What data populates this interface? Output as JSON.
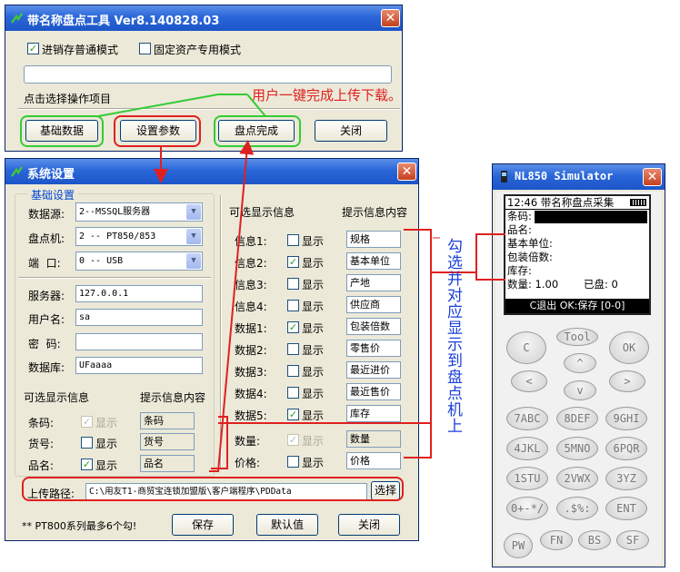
{
  "win1": {
    "title": "带名称盘点工具 Ver8.140828.03",
    "mode_normal": "进销存普通模式",
    "mode_asset": "固定资产专用模式",
    "hint": "点击选择操作项目",
    "btn_basic": "基础数据",
    "btn_params": "设置参数",
    "btn_done": "盘点完成",
    "btn_close": "关闭",
    "callout": "用户一键完成上传下载。"
  },
  "win2": {
    "title": "系统设置",
    "basic_group": "基础设置",
    "labels": {
      "datasource": "数据源:",
      "device": "盘点机:",
      "port": "端  口:",
      "server": "服务器:",
      "user": "用户名:",
      "password": "密  码:",
      "database": "数据库:"
    },
    "datasource_value": "2--MSSQL服务器",
    "device_value": "2 -- PT850/853",
    "port_value": "0 -- USB",
    "server_value": "127.0.0.1",
    "user_value": "sa",
    "password_value": "",
    "database_value": "UFaaaa",
    "left_hdr_opt": "可选显示信息",
    "left_hdr_prompt": "提示信息内容",
    "left_rows": [
      {
        "label": "条码:",
        "show": "显示",
        "checked": true,
        "disabled": true,
        "prompt": "条码"
      },
      {
        "label": "货号:",
        "show": "显示",
        "checked": false,
        "disabled": false,
        "prompt": "货号"
      },
      {
        "label": "品名:",
        "show": "显示",
        "checked": true,
        "disabled": false,
        "prompt": "品名"
      }
    ],
    "right_hdr_opt": "可选显示信息",
    "right_hdr_prompt": "提示信息内容",
    "right_rows": [
      {
        "label": "信息1:",
        "show": "显示",
        "checked": false,
        "disabled": false,
        "prompt": "规格"
      },
      {
        "label": "信息2:",
        "show": "显示",
        "checked": true,
        "disabled": false,
        "prompt": "基本单位"
      },
      {
        "label": "信息3:",
        "show": "显示",
        "checked": false,
        "disabled": false,
        "prompt": "产地"
      },
      {
        "label": "信息4:",
        "show": "显示",
        "checked": false,
        "disabled": false,
        "prompt": "供应商"
      },
      {
        "label": "数据1:",
        "show": "显示",
        "checked": true,
        "disabled": false,
        "prompt": "包装倍数"
      },
      {
        "label": "数据2:",
        "show": "显示",
        "checked": false,
        "disabled": false,
        "prompt": "零售价"
      },
      {
        "label": "数据3:",
        "show": "显示",
        "checked": false,
        "disabled": false,
        "prompt": "最近进价"
      },
      {
        "label": "数据4:",
        "show": "显示",
        "checked": false,
        "disabled": false,
        "prompt": "最近售价"
      },
      {
        "label": "数据5:",
        "show": "显示",
        "checked": true,
        "disabled": false,
        "prompt": "库存"
      }
    ],
    "qty_row": {
      "label": "数量:",
      "show": "显示",
      "checked": true,
      "disabled": true,
      "prompt": "数量"
    },
    "price_row": {
      "label": "价格:",
      "show": "显示",
      "checked": false,
      "disabled": false,
      "prompt": "价格"
    },
    "upload_label": "上传路径:",
    "upload_path": "C:\\用友T1-商贸宝连锁加盟版\\客户端程序\\PDData",
    "btn_choose": "选择",
    "note": "** PT800系列最多6个勾!",
    "btn_save": "保存",
    "btn_default": "默认值",
    "btn_close": "关闭"
  },
  "vertical_note": "勾选并对应显示到盘点机上",
  "sim": {
    "title": "NL850 Simulator",
    "screen_header": "12:46 带名称盘点采集",
    "lines": {
      "barcode": "条码:",
      "name": "品名:",
      "unit": "基本单位:",
      "pack": "包装倍数:",
      "stock": "库存:",
      "qty": "数量: 1.00",
      "counted": "已盘: 0"
    },
    "status": "C退出 OK:保存 [0-0]",
    "keys": {
      "c": "C",
      "tool": "Tool",
      "ok": "OK",
      "left": "<",
      "up": "^",
      "down": "v",
      "right": ">",
      "k7": "7ABC",
      "k8": "8DEF",
      "k9": "9GHI",
      "k4": "4JKL",
      "k5": "5MNO",
      "k6": "6PQR",
      "k1": "1STU",
      "k2": "2VWX",
      "k3": "3YZ",
      "k0": "0+-*/",
      "kdot": ".$%:",
      "ent": "ENT",
      "pw": "PW",
      "fn": "FN",
      "bs": "BS",
      "sf": "SF"
    }
  },
  "colors": {
    "annot_red": "#e02020",
    "annot_green": "#33cc33",
    "title_blue": "#2a66d8"
  }
}
